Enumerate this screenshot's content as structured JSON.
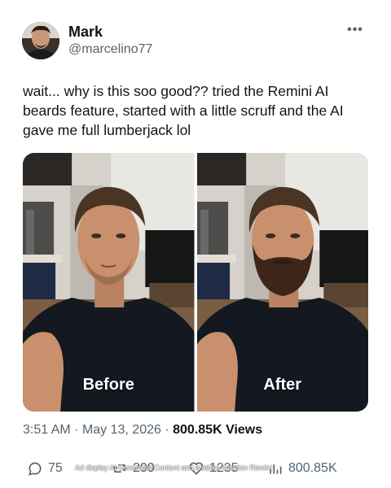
{
  "author": {
    "name": "Mark",
    "handle": "@marcelino77",
    "avatar_icon": "profile-photo"
  },
  "tweet": {
    "text": "wait... why is this soo good?? tried the Remini AI beards feature, started with a little scruff and the AI gave me full lumberjack lol"
  },
  "media": {
    "before_label": "Before",
    "after_label": "After"
  },
  "meta": {
    "time": "3:51 AM",
    "date": "May 13, 2026",
    "separator": "·",
    "views_count": "800.85K Views"
  },
  "actions": {
    "replies": "75",
    "retweets": "200",
    "likes": "1235",
    "views": "800.85K"
  },
  "overlay": {
    "ad_text": "Ad display AI Generated Content and enables creation Remini"
  },
  "colors": {
    "text_primary": "#0f1419",
    "text_secondary": "#536471",
    "shirt": "#141820",
    "skin": "#c8906c"
  }
}
